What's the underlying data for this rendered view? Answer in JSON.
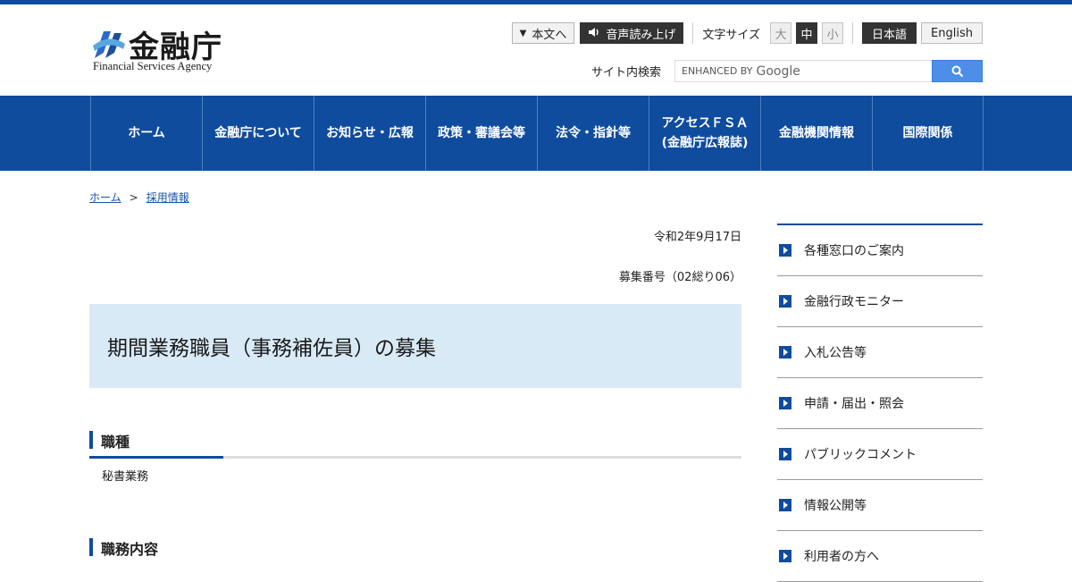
{
  "header": {
    "logo_text": "金融庁",
    "logo_sub": "Financial Services Agency",
    "skip_to_content": "本文へ",
    "read_aloud": "音声読み上げ",
    "font_size_label": "文字サイズ",
    "font_sizes": [
      "大",
      "中",
      "小"
    ],
    "font_size_selected": "中",
    "languages": [
      "日本語",
      "English"
    ],
    "language_selected": "日本語",
    "search_label": "サイト内検索",
    "search_placeholder_prefix": "ENHANCED BY",
    "search_placeholder_brand": "Google",
    "search_icon": "search-icon"
  },
  "nav": {
    "items": [
      "ホーム",
      "金融庁について",
      "お知らせ・広報",
      "政策・審議会等",
      "法令・指針等",
      "アクセスＦＳＡ\n(金融庁広報誌)",
      "金融機関情報",
      "国際関係"
    ]
  },
  "breadcrumb": {
    "home": "ホーム",
    "separator": ">",
    "current": "採用情報"
  },
  "main": {
    "date": "令和2年9月17日",
    "recruitment_no": "募集番号（02総り06）",
    "title": "期間業務職員（事務補佐員）の募集",
    "section1_heading": "職種",
    "section1_body": "秘書業務",
    "section2_heading": "職務内容"
  },
  "sidebar": {
    "items": [
      "各種窓口のご案内",
      "金融行政モニター",
      "入札公告等",
      "申請・届出・照会",
      "パブリックコメント",
      "情報公開等",
      "利用者の方へ"
    ]
  },
  "colors": {
    "brand_blue": "#0f4c9e",
    "title_bg": "#d9eaf7",
    "search_button": "#4d8fe8"
  }
}
